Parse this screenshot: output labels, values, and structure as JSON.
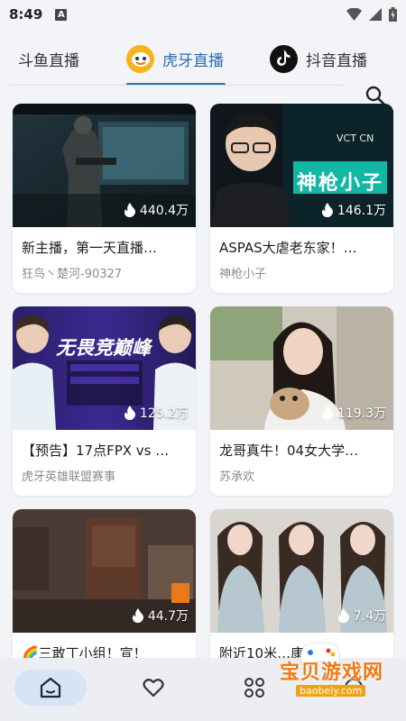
{
  "status": {
    "time": "8:49",
    "notif_letter": "A"
  },
  "tabs": [
    {
      "label": "斗鱼直播"
    },
    {
      "label": "虎牙直播"
    },
    {
      "label": "抖音直播"
    }
  ],
  "accent_color": "#2c6dad",
  "cards": [
    {
      "title": "新主播，第一天直播…",
      "author": "狂鸟丶楚河-90327",
      "views": "440.4万"
    },
    {
      "title": "ASPAS大虐老东家！…",
      "author": "神枪小子",
      "views": "146.1万"
    },
    {
      "title": "【预告】17点FPX vs …",
      "author": "虎牙英雄联盟赛事",
      "views": "125.2万"
    },
    {
      "title": "龙哥真牛！04女大学…",
      "author": "苏承欢",
      "views": "119.3万"
    },
    {
      "title": "🌈三敢丁小组！宣！",
      "author": "",
      "views": "44.7万"
    },
    {
      "title": "附近10米…康总…",
      "author": "",
      "views": "7.4万"
    }
  ],
  "thumb_text": {
    "card2_badge": "神枪小子",
    "card2_logo": "VCT CN",
    "card3_banner": "无畏竞巅峰"
  },
  "watermark": {
    "title": "宝贝游戏网",
    "url": "baobeiy.com"
  },
  "icons": [
    "flame-icon",
    "search-icon",
    "home-icon",
    "heart-icon",
    "apps-icon",
    "wifi-icon",
    "signal-icon",
    "battery-icon"
  ]
}
